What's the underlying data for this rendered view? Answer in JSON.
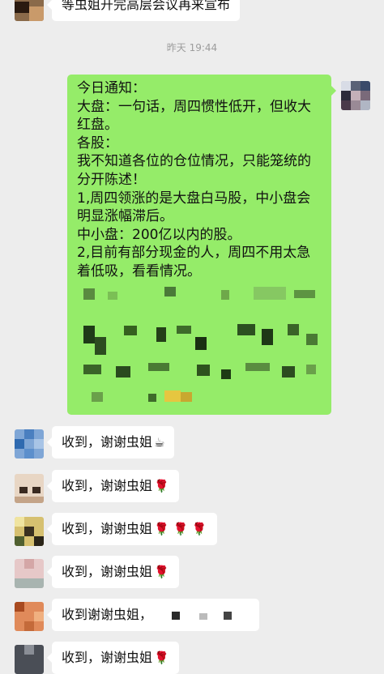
{
  "top_message": {
    "text": "等虫姐开完高层会议再来宣布"
  },
  "timestamp": "昨天 19:44",
  "main_message": {
    "lines": [
      "今日通知：",
      "大盘：一句话，周四惯性低开，但收大",
      "红盘。",
      "各股：",
      "我不知道各位的仓位情况，只能笼统的",
      "分开陈述！",
      "1,周四领涨的是大盘白马股，中小盘会",
      "明显涨幅滞后。",
      "中小盘：200亿以内的股。",
      "2,目前有部分现金的人，周四不用太急",
      "着低吸，看看情况。"
    ]
  },
  "replies": [
    {
      "text": "收到，谢谢虫姐",
      "emoji": "☕"
    },
    {
      "text": "收到，谢谢虫姐",
      "emoji": "🌹"
    },
    {
      "text": "收到，谢谢虫姐",
      "emoji": "🌹 🌹 🌹"
    },
    {
      "text": "收到，谢谢虫姐",
      "emoji": "🌹"
    },
    {
      "text": "收到谢谢虫姐，",
      "emoji": ""
    },
    {
      "text": "收到，谢谢虫姐",
      "emoji": "🌹"
    }
  ]
}
